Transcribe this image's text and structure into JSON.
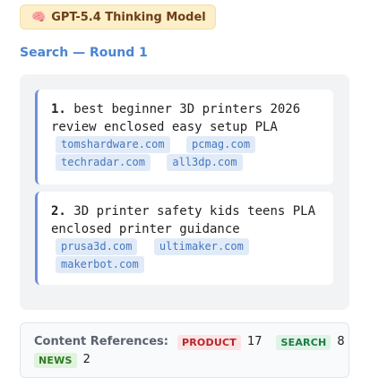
{
  "model_badge": {
    "icon": "brain-icon",
    "label": "GPT-5.4 Thinking Model",
    "colors": {
      "background": "#fcefc9",
      "text": "#6d3f16"
    }
  },
  "search_round": {
    "title": "Search — Round 1",
    "queries": [
      {
        "number": "1.",
        "text": "best beginner 3D printers 2026 review enclosed easy setup PLA",
        "domains": [
          "tomshardware.com",
          "pcmag.com",
          "techradar.com",
          "all3dp.com"
        ]
      },
      {
        "number": "2.",
        "text": "3D printer safety kids teens PLA enclosed printer guidance",
        "domains": [
          "prusa3d.com",
          "ultimaker.com",
          "makerbot.com"
        ]
      }
    ]
  },
  "content_references": {
    "label": "Content References:",
    "items": [
      {
        "type": "PRODUCT",
        "count": "17",
        "color": "#b3262d"
      },
      {
        "type": "SEARCH",
        "count": "8",
        "color": "#1f7a45"
      },
      {
        "type": "NEWS",
        "count": "2",
        "color": "#2d7a22"
      }
    ]
  }
}
